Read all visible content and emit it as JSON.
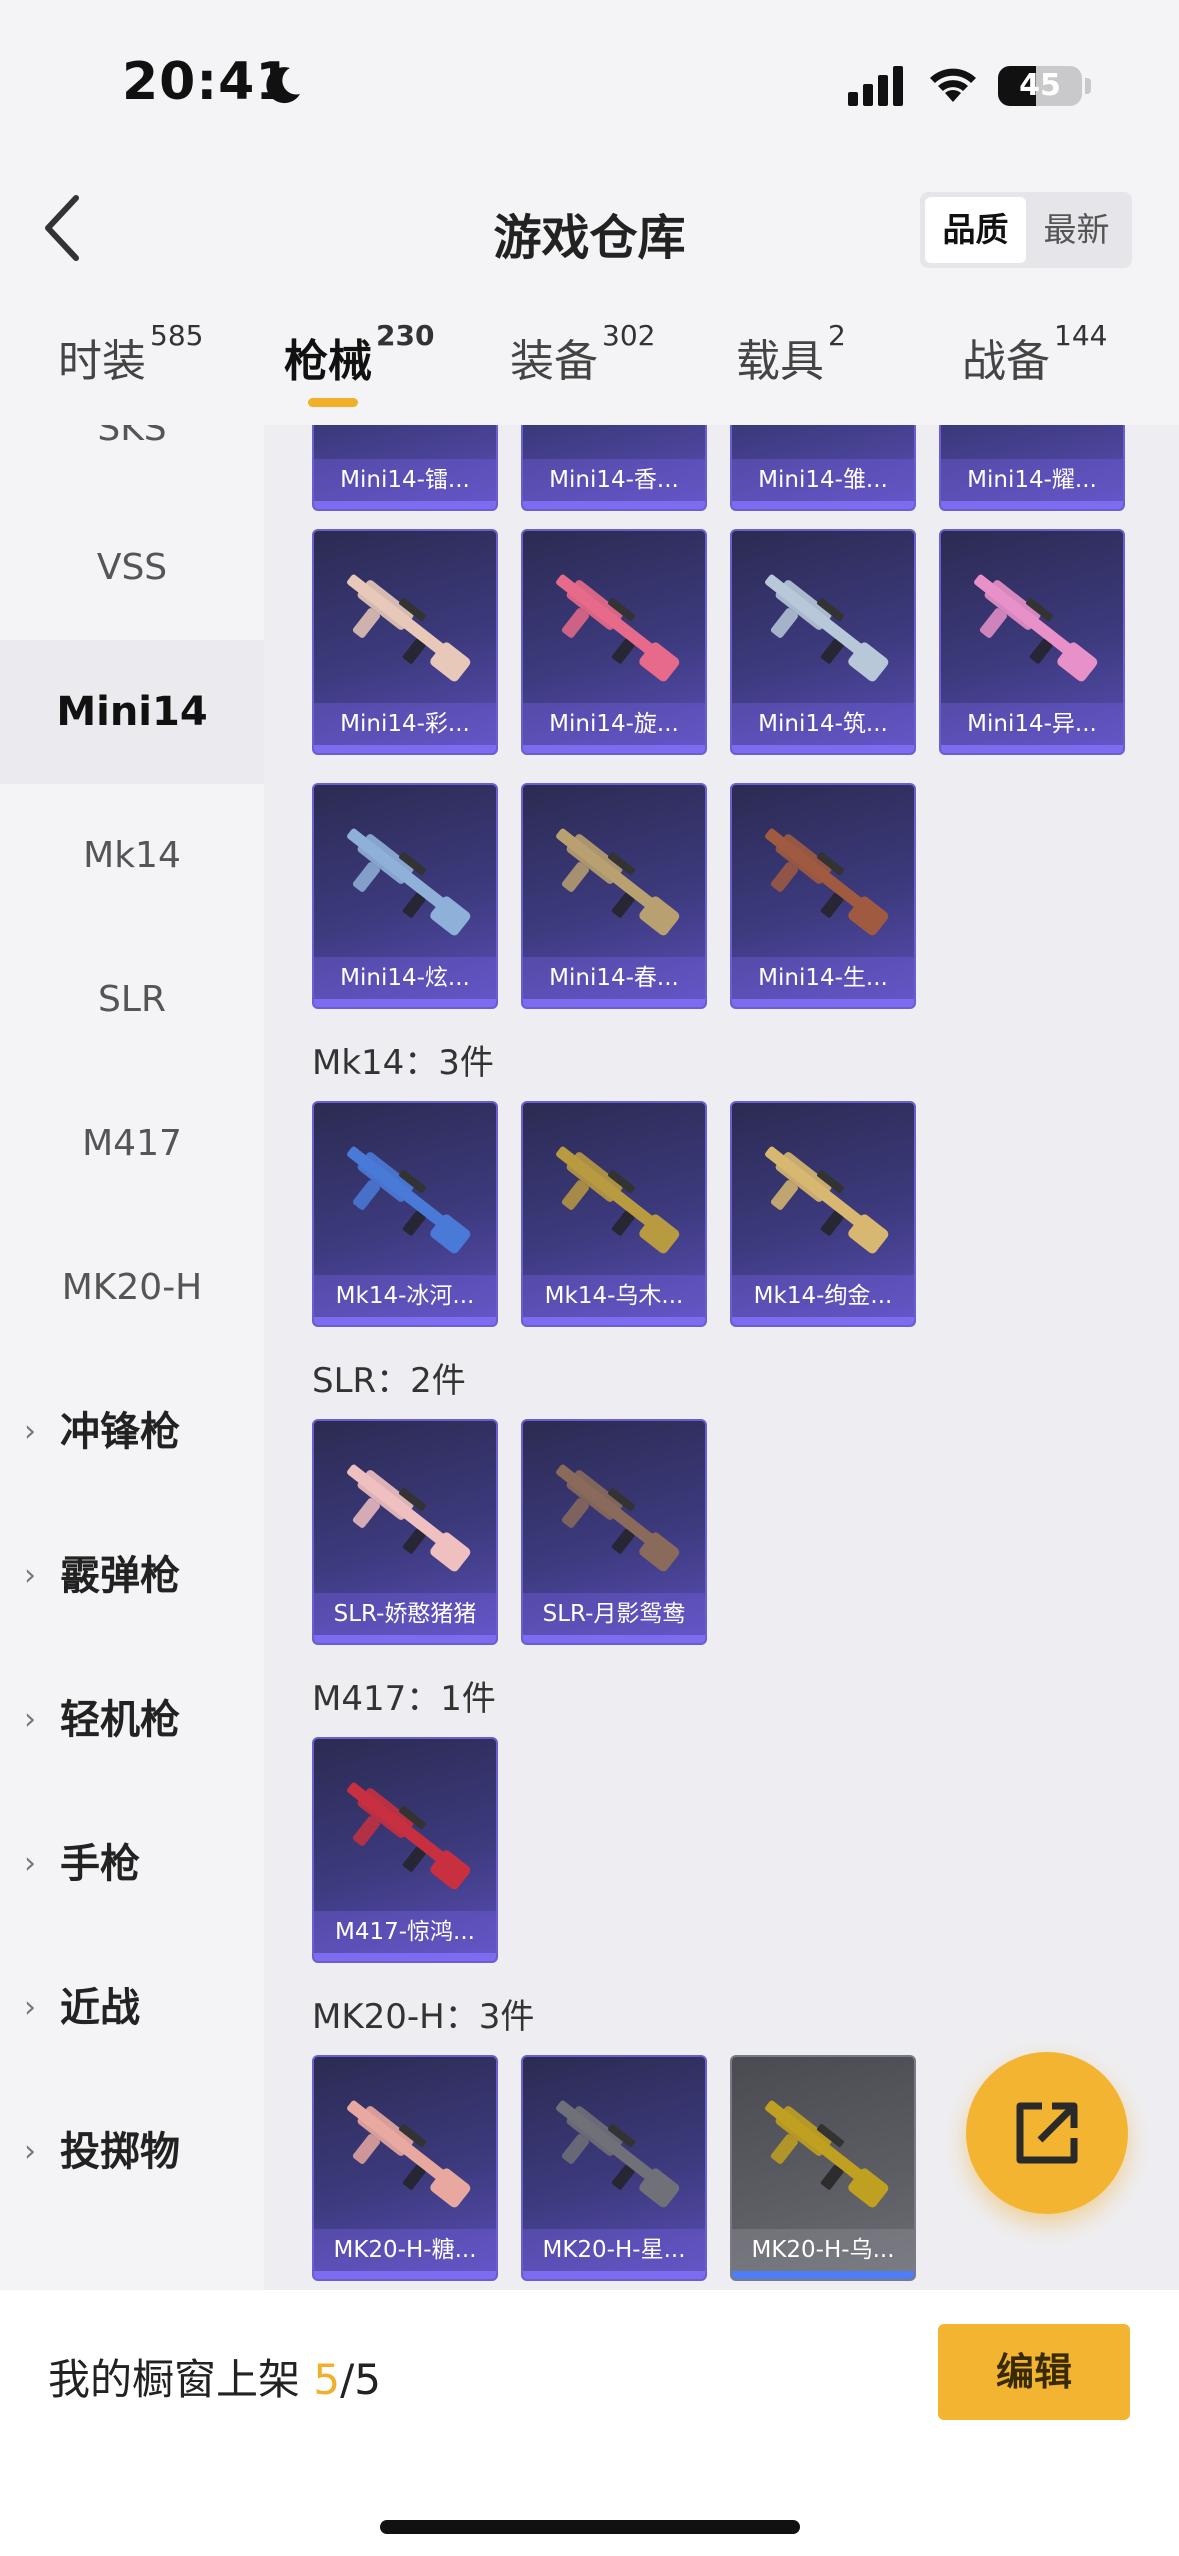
{
  "status": {
    "time": "20:41",
    "battery": "45",
    "battery_level": 0.45
  },
  "header": {
    "title": "游戏仓库",
    "sort_quality": "品质",
    "sort_newest": "最新"
  },
  "tabs": [
    {
      "label": "时装",
      "count": "585"
    },
    {
      "label": "枪械",
      "count": "230"
    },
    {
      "label": "装备",
      "count": "302"
    },
    {
      "label": "载具",
      "count": "2"
    },
    {
      "label": "战备",
      "count": "144"
    }
  ],
  "sidebar": {
    "items": [
      "SKS",
      "VSS",
      "Mini14",
      "Mk14",
      "SLR",
      "M417",
      "MK20-H"
    ],
    "categories": [
      "冲锋枪",
      "霰弹枪",
      "轻机枪",
      "手枪",
      "近战",
      "投掷物"
    ]
  },
  "sections": {
    "mini14_row1": [
      "Mini14-镭...",
      "Mini14-香...",
      "Mini14-雏...",
      "Mini14-耀..."
    ],
    "mini14_row2": [
      "Mini14-彩...",
      "Mini14-旋...",
      "Mini14-筑...",
      "Mini14-异..."
    ],
    "mini14_row3": [
      "Mini14-炫...",
      "Mini14-春...",
      "Mini14-生..."
    ],
    "mk14_title": "Mk14：3件",
    "mk14": [
      "Mk14-冰河...",
      "Mk14-乌木...",
      "Mk14-绚金..."
    ],
    "slr_title": "SLR：2件",
    "slr": [
      "SLR-娇憨猪猪",
      "SLR-月影鸳鸯"
    ],
    "m417_title": "M417：1件",
    "m417": [
      "M417-惊鸿..."
    ],
    "mk20_title": "MK20-H：3件",
    "mk20": [
      "MK20-H-糖...",
      "MK20-H-星...",
      "MK20-H-乌..."
    ]
  },
  "gun_colors": {
    "mini14_row2": [
      "#e8c8b8",
      "#e86a8a",
      "#b8c8d8",
      "#e890c8"
    ],
    "mini14_row3": [
      "#8fb0d8",
      "#b8a070",
      "#a05a40"
    ],
    "mk14": [
      "#4a7ad8",
      "#b89a40",
      "#d8b870"
    ],
    "slr": [
      "#f0c0c0",
      "#8a6a5a"
    ],
    "m417": [
      "#c83040"
    ],
    "mk20": [
      "#e8a8a0",
      "#707078",
      "#c0a020"
    ]
  },
  "bottom": {
    "showcase_label": "我的橱窗上架 ",
    "showcase_count": "5",
    "showcase_total": "/5",
    "edit": "编辑"
  }
}
